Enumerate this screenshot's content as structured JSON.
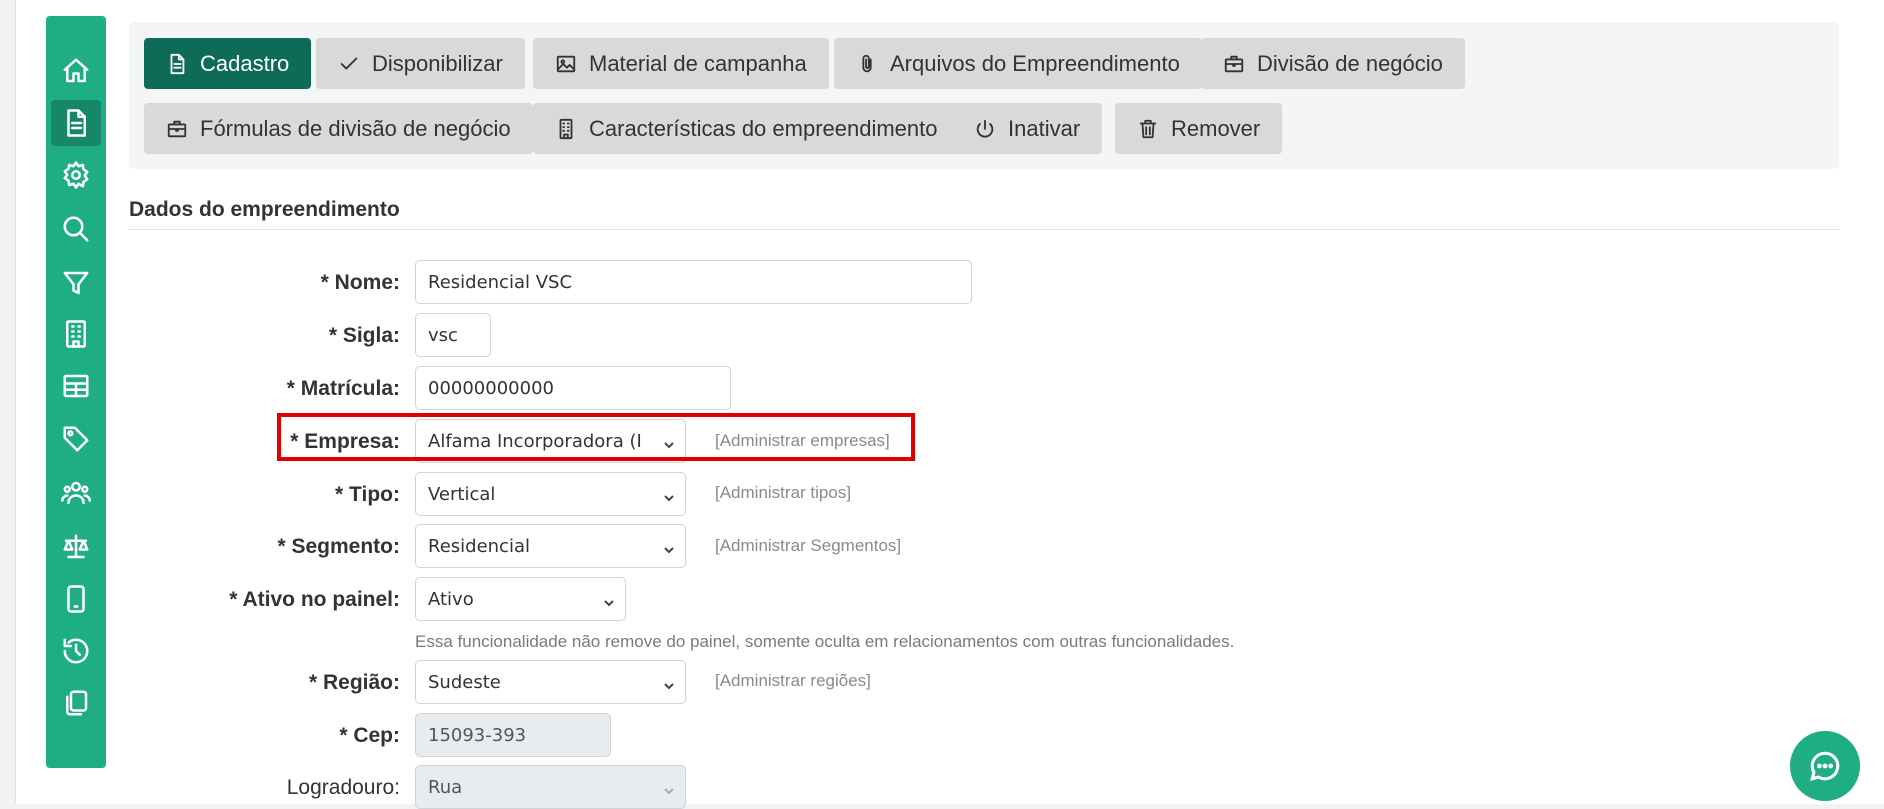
{
  "sidebar": {
    "items": [
      {
        "icon": "home-icon",
        "active": false
      },
      {
        "icon": "document-icon",
        "active": true
      },
      {
        "icon": "gear-icon",
        "active": false
      },
      {
        "icon": "search-icon",
        "active": false
      },
      {
        "icon": "filter-icon",
        "active": false
      },
      {
        "icon": "building-icon",
        "active": false
      },
      {
        "icon": "table-icon",
        "active": false
      },
      {
        "icon": "tag-icon",
        "active": false
      },
      {
        "icon": "users-icon",
        "active": false
      },
      {
        "icon": "scale-icon",
        "active": false
      },
      {
        "icon": "mobile-icon",
        "active": false
      },
      {
        "icon": "history-icon",
        "active": false
      },
      {
        "icon": "copy-icon",
        "active": false
      }
    ],
    "color": "#1fae83"
  },
  "toolbar": {
    "buttons": [
      {
        "label": "Cadastro",
        "icon": "document-icon",
        "active": true
      },
      {
        "label": "Disponibilizar",
        "icon": "check-icon"
      },
      {
        "label": "Material de campanha",
        "icon": "image-icon"
      },
      {
        "label": "Arquivos do Empreendimento",
        "icon": "paperclip-icon"
      },
      {
        "label": "Divisão de negócio",
        "icon": "briefcase-icon"
      },
      {
        "label": "Fórmulas de divisão de negócio",
        "icon": "briefcase-icon"
      },
      {
        "label": "Características do empreendimento",
        "icon": "building-icon"
      },
      {
        "label": "Inativar",
        "icon": "power-icon"
      },
      {
        "label": "Remover",
        "icon": "trash-icon"
      }
    ],
    "active_color": "#0d6b58"
  },
  "section": {
    "title": "Dados do empreendimento"
  },
  "form": {
    "nome": {
      "label": "* Nome:",
      "value": "Residencial VSC"
    },
    "sigla": {
      "label": "* Sigla:",
      "value": "vsc"
    },
    "matricula": {
      "label": "* Matrícula:",
      "value": "00000000000"
    },
    "empresa": {
      "label": "* Empresa:",
      "value": "Alfama Incorporadora (I",
      "admin": "[Administrar empresas]"
    },
    "tipo": {
      "label": "* Tipo:",
      "value": "Vertical",
      "admin": "[Administrar tipos]"
    },
    "segmento": {
      "label": "* Segmento:",
      "value": "Residencial",
      "admin": "[Administrar Segmentos]"
    },
    "ativo": {
      "label": "* Ativo no painel:",
      "value": "Ativo",
      "help": "Essa funcionalidade não remove do painel, somente oculta em relacionamentos com outras funcionalidades."
    },
    "regiao": {
      "label": "* Região:",
      "value": "Sudeste",
      "admin": "[Administrar regiões]"
    },
    "cep": {
      "label": "* Cep:",
      "value": "15093-393"
    },
    "logradouro": {
      "label": "Logradouro:",
      "value": "Rua"
    }
  },
  "highlight_color": "#e10000",
  "chat": {
    "icon": "chat-icon"
  }
}
